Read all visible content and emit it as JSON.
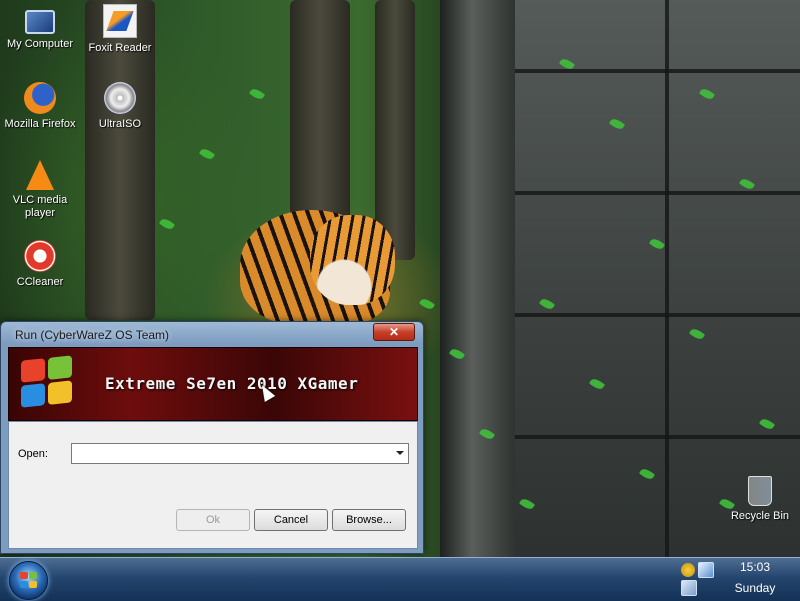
{
  "desktop": {
    "icons": [
      {
        "label": "My Computer",
        "icon": "computer-icon"
      },
      {
        "label": "Foxit Reader",
        "icon": "foxit-reader-icon"
      },
      {
        "label": "Mozilla Firefox",
        "icon": "firefox-icon"
      },
      {
        "label": "UltraISO",
        "icon": "ultraiso-icon"
      },
      {
        "label": "VLC media player",
        "icon": "vlc-icon"
      },
      {
        "label": "CCleaner",
        "icon": "ccleaner-icon"
      },
      {
        "label": "Recycle Bin",
        "icon": "recycle-bin-icon"
      }
    ]
  },
  "run_dialog": {
    "title": "Run (CyberWareZ OS Team)",
    "close_label": "✕",
    "banner_text": "Extreme Se7en 2010 XGamer",
    "open_label": "Open:",
    "open_value": "",
    "buttons": {
      "ok": "Ok",
      "cancel": "Cancel",
      "browse": "Browse..."
    }
  },
  "taskbar": {
    "clock_time": "15:03",
    "clock_day": "Sunday",
    "tray_icons": [
      "s-tray-icon",
      "bluetooth-tray-icon",
      "network-tray-icon"
    ]
  }
}
